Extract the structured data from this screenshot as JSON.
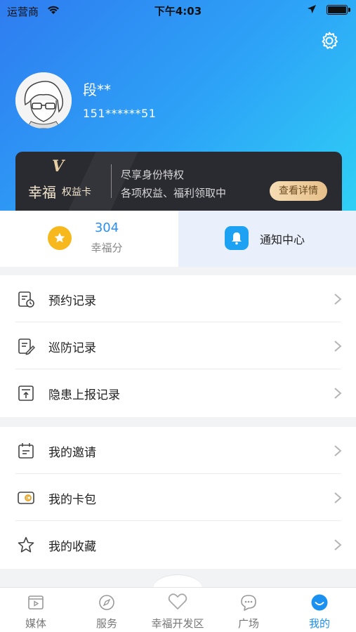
{
  "status_bar": {
    "carrier": "运营商",
    "time": "下午4:03"
  },
  "profile": {
    "name": "段**",
    "phone": "151******51"
  },
  "vip_card": {
    "badge": "V",
    "brand": "幸福",
    "brand_sub": "权益卡",
    "line1": "尽享身份特权",
    "line2": "各项权益、福利领取中",
    "detail_button": "查看详情"
  },
  "stats": {
    "points_value": "304",
    "points_label": "幸福分",
    "notification_label": "通知中心"
  },
  "menu_group_1": [
    {
      "label": "预约记录",
      "icon": "calendar-record-icon"
    },
    {
      "label": "巡防记录",
      "icon": "patrol-record-icon"
    },
    {
      "label": "隐患上报记录",
      "icon": "hazard-report-icon"
    }
  ],
  "menu_group_2": [
    {
      "label": "我的邀请",
      "icon": "invitation-icon"
    },
    {
      "label": "我的卡包",
      "icon": "card-wallet-icon"
    },
    {
      "label": "我的收藏",
      "icon": "star-icon"
    }
  ],
  "tabbar": [
    {
      "label": "媒体",
      "icon": "media-icon"
    },
    {
      "label": "服务",
      "icon": "compass-icon"
    },
    {
      "label": "幸福开发区",
      "icon": "heart-icon"
    },
    {
      "label": "广场",
      "icon": "chat-bubble-icon"
    },
    {
      "label": "我的",
      "icon": "smile-icon",
      "active": true
    }
  ],
  "colors": {
    "accent": "#1a90f0",
    "header_start": "#2f7cf0",
    "header_end": "#2fd0f5",
    "gold": "#f7b81d"
  }
}
